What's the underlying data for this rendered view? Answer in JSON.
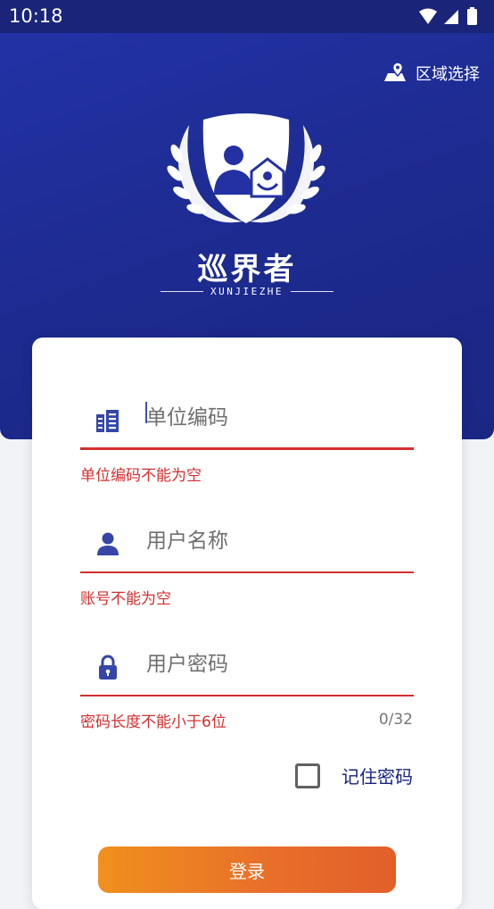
{
  "status_bar": {
    "time": "10:18",
    "icons": [
      "wifi-icon",
      "cellular-icon",
      "battery-icon"
    ]
  },
  "header": {
    "region_label": "区域选择",
    "region_icon": "map-pin-icon"
  },
  "logo": {
    "title": "巡界者",
    "subtitle": "XUNJIEZHE"
  },
  "form": {
    "org_code": {
      "placeholder": "单位编码",
      "value": "",
      "icon": "building-icon",
      "error": "单位编码不能为空"
    },
    "username": {
      "placeholder": "用户名称",
      "value": "",
      "icon": "person-icon",
      "error": "账号不能为空"
    },
    "password": {
      "placeholder": "用户密码",
      "value": "",
      "icon": "lock-icon",
      "error": "密码长度不能小于6位",
      "counter": "0/32"
    },
    "remember_label": "记住密码",
    "remember_checked": false,
    "login_label": "登录"
  },
  "colors": {
    "header_bg": "#1f2d96",
    "icon": "#3546a8",
    "error": "#d32f2f",
    "button_start": "#f0901e",
    "button_end": "#e15f2a"
  }
}
